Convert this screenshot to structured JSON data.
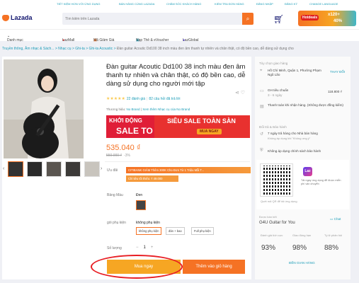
{
  "topbar": {
    "links": [
      "TIẾT KIỆM HƠN VỚI ỨNG DỤNG",
      "BÁN HÀNG CÙNG LAZADA",
      "CHĂM SÓC KHÁCH HÀNG",
      "KIỂM TRA ĐƠN HÀNG",
      "ĐĂNG NHẬP",
      "ĐĂNG KÝ",
      "CHANGE LANGUAGE"
    ]
  },
  "header": {
    "logo": "Lazada",
    "search_placeholder": "Tìm kiếm trên Lazada",
    "promo_badge": "Hotdeals",
    "promo_line1": "x120+",
    "promo_line2": "40%"
  },
  "nav": {
    "category": "Danh mục",
    "items": [
      "LazMall",
      "Mã Giảm Giá",
      "Nạp Thẻ & eVoucher",
      "LazGlobal"
    ]
  },
  "breadcrumb": {
    "items": [
      "Truyền thông, Âm nhạc & Sách...",
      "Nhạc cụ",
      "Ghi-ta",
      "Ghi-ta Acoustic"
    ],
    "current": "Đàn guitar Acoutic Dd100 38 inch màu đen âm thanh tự nhiên và chân thật, có độ bền cao, dễ dàng sử dụng cho"
  },
  "product": {
    "title": "Đàn guitar Acoutic Dd100 38 inch màu đen âm thanh tự nhiên và chân thật, có độ bền cao, dễ dàng sử dụng cho người mới tập",
    "stars": "★★★★★",
    "ratings": "22 đánh giá",
    "answers": "82 câu hỏi đã trả lời",
    "brand_label": "Thương hiệu:",
    "brand_value": "No Brand",
    "brand_more": "Xem thêm Nhạc cụ của No Brand",
    "price": "535.040 ₫",
    "old_price": "550.000 ₫",
    "discount": "-3%",
    "sale_left_1": "KHỞI ĐỘNG",
    "sale_left_2": "SALE TO",
    "sale_right_1": "SIÊU SALE TOÀN SÀN",
    "sale_right_2": "MUA NGAY",
    "promo_label": "Ưu đãi",
    "voucher_1": "CITIBANK GIẢM Thêm 300K Cho Đơn Từ 1 Triệu Mỗi T...",
    "voucher_2": "Chỉ tiêu tối thiểu: ₫ 49.000",
    "color_label": "Bảng Màu",
    "color_value": "Đen",
    "option_label": "gói phụ kiện",
    "option_value": "không phụ kiện",
    "options": [
      "không phụ kiện",
      "đàn + bao",
      "Full phụ kiện"
    ],
    "qty_label": "Số lượng",
    "qty_minus": "−",
    "qty_value": "1",
    "qty_plus": "+",
    "buy_now": "Mua ngay",
    "add_to_cart": "Thêm vào giỏ hàng"
  },
  "delivery": {
    "heading": "Tùy chọn giao hàng",
    "address": "Hồ Chí Minh, Quận 1, Phường Phạm Ngũ Lão",
    "change": "THAY ĐỔI",
    "standard": "GH tiêu chuẩn",
    "standard_days": "3 - 6 ngày",
    "standard_price": "118.800 ₫",
    "cod": "Thanh toán khi nhận hàng. (Không được đồng kiểm)",
    "returns_heading": "Đổi trả & Bảo hành",
    "returns_1": "7 ngày trả hàng cho Nhà bán hàng",
    "returns_1b": "Không áp dụng khi \"Không ưng ý\"",
    "warranty": "Không áp dụng chính sách bảo hành",
    "app_text": "Tải ngay ứng dụng để được miễn phí vận chuyển",
    "scan_text": "Quét mã QR để tải ứng dụng",
    "app_icon": "Laz"
  },
  "seller": {
    "label": "Được bán bởi",
    "name": "G4U Guitar for You",
    "chat": "Chat",
    "stat_labels": [
      "Đánh giá tích cực",
      "Giao đúng hạn",
      "Tỷ lệ phản hồi"
    ],
    "stat_values": [
      "93%",
      "98%",
      "88%"
    ],
    "link": "ĐẾN GIAN HÀNG"
  }
}
